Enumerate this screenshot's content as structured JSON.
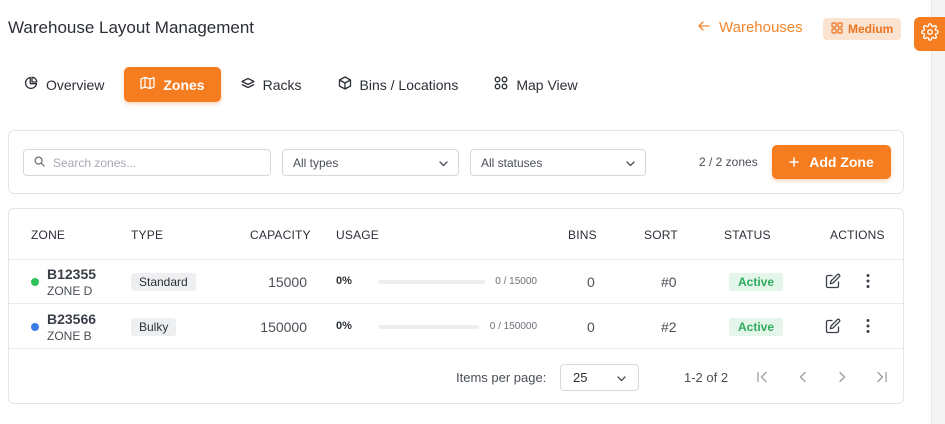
{
  "header": {
    "title": "Warehouse Layout Management",
    "back_label": "Warehouses",
    "size_label": "Medium"
  },
  "tabs": [
    {
      "label": "Overview",
      "icon": "pie-chart-icon",
      "active": false
    },
    {
      "label": "Zones",
      "icon": "map-icon",
      "active": true
    },
    {
      "label": "Racks",
      "icon": "layers-icon",
      "active": false
    },
    {
      "label": "Bins / Locations",
      "icon": "box-icon",
      "active": false
    },
    {
      "label": "Map View",
      "icon": "grid-icon",
      "active": false
    }
  ],
  "toolbar": {
    "search_placeholder": "Search zones...",
    "type_filter": "All types",
    "status_filter": "All statuses",
    "count": "2 / 2 zones",
    "add_label": "Add Zone"
  },
  "table": {
    "columns": [
      "ZONE",
      "TYPE",
      "CAPACITY",
      "USAGE",
      "BINS",
      "SORT",
      "STATUS",
      "ACTIONS"
    ],
    "rows": [
      {
        "code": "B12355",
        "name": "ZONE D",
        "type": "Standard",
        "capacity": "15000",
        "usage_pct": "0%",
        "usage_fraction": 0,
        "usage_text": "0 / 15000",
        "bins": "0",
        "sort": "#0",
        "status": "Active",
        "dot_color": "#2ec15a"
      },
      {
        "code": "B23566",
        "name": "ZONE B",
        "type": "Bulky",
        "capacity": "150000",
        "usage_pct": "0%",
        "usage_fraction": 0,
        "usage_text": "0 / 150000",
        "bins": "0",
        "sort": "#2",
        "status": "Active",
        "dot_color": "#3b7de8"
      }
    ]
  },
  "pagination": {
    "items_per_page_label": "Items per page:",
    "items_per_page": "25",
    "range": "1-2 of 2"
  },
  "colors": {
    "accent": "#f57c1f",
    "active_green": "#2eab5c"
  }
}
